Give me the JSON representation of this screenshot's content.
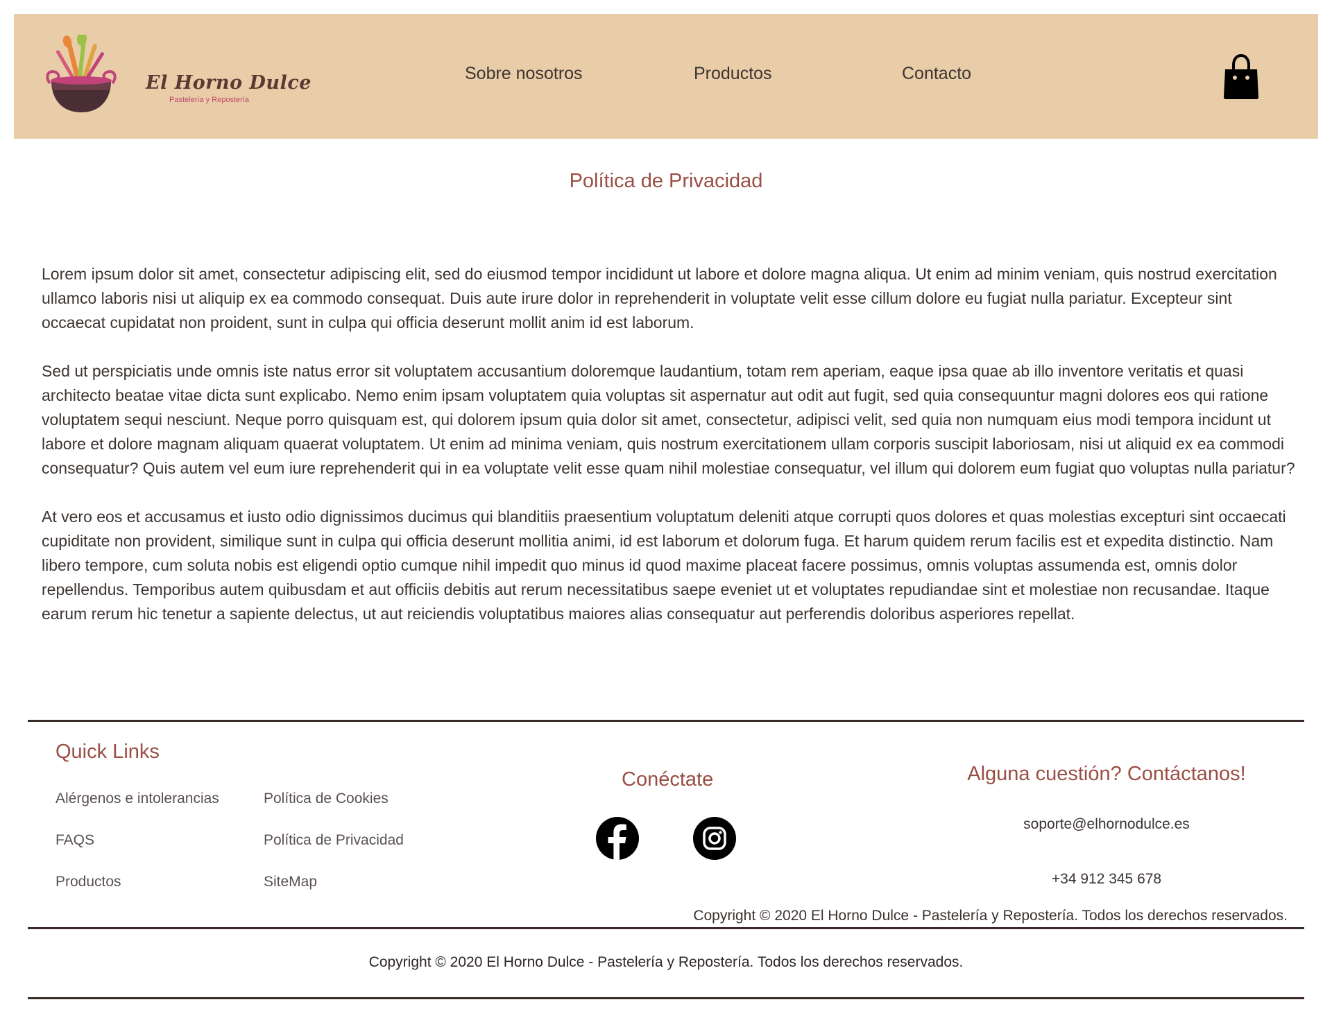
{
  "header": {
    "logo": {
      "name": "El Horno Dulce",
      "subtitle": "Pastelería y Repostería"
    },
    "nav": {
      "about": "Sobre nosotros",
      "products": "Productos",
      "contact": "Contacto"
    },
    "cart_icon": "shopping-bag-icon"
  },
  "main": {
    "title": "Política de Privacidad",
    "paragraphs": [
      "Lorem ipsum dolor sit amet, consectetur adipiscing elit, sed do eiusmod tempor incididunt ut labore et dolore magna aliqua. Ut enim ad minim veniam, quis nostrud exercitation ullamco laboris nisi ut aliquip ex ea commodo consequat. Duis aute irure dolor in reprehenderit in voluptate velit esse cillum dolore eu fugiat nulla pariatur. Excepteur sint occaecat cupidatat non proident, sunt in culpa qui officia deserunt mollit anim id est laborum.",
      "Sed ut perspiciatis unde omnis iste natus error sit voluptatem accusantium doloremque laudantium, totam rem aperiam, eaque ipsa quae ab illo inventore veritatis et quasi architecto beatae vitae dicta sunt explicabo. Nemo enim ipsam voluptatem quia voluptas sit aspernatur aut odit aut fugit, sed quia consequuntur magni dolores eos qui ratione voluptatem sequi nesciunt. Neque porro quisquam est, qui dolorem ipsum quia dolor sit amet, consectetur, adipisci velit, sed quia non numquam eius modi tempora incidunt ut labore et dolore magnam aliquam quaerat voluptatem. Ut enim ad minima veniam, quis nostrum exercitationem ullam corporis suscipit laboriosam, nisi ut aliquid ex ea commodi consequatur? Quis autem vel eum iure reprehenderit qui in ea voluptate velit esse quam nihil molestiae consequatur, vel illum qui dolorem eum fugiat quo voluptas nulla pariatur?",
      "At vero eos et accusamus et iusto odio dignissimos ducimus qui blanditiis praesentium voluptatum deleniti atque corrupti quos dolores et quas molestias excepturi sint occaecati cupiditate non provident, similique sunt in culpa qui officia deserunt mollitia animi, id est laborum et dolorum fuga. Et harum quidem rerum facilis est et expedita distinctio. Nam libero tempore, cum soluta nobis est eligendi optio cumque nihil impedit quo minus id quod maxime placeat facere possimus, omnis voluptas assumenda est, omnis dolor repellendus. Temporibus autem quibusdam et aut officiis debitis aut rerum necessitatibus saepe eveniet ut et voluptates repudiandae sint et molestiae non recusandae. Itaque earum rerum hic tenetur a sapiente delectus, ut aut reiciendis voluptatibus maiores alias consequatur aut perferendis doloribus asperiores repellat."
    ]
  },
  "footer": {
    "quick_links": {
      "title": "Quick Links",
      "links": [
        "Alérgenos e intolerancias",
        "Política de Cookies",
        "FAQS",
        "Política de Privacidad",
        "Productos",
        "SiteMap"
      ]
    },
    "connect": {
      "title": "Conéctate",
      "icons": [
        "facebook-icon",
        "instagram-icon"
      ]
    },
    "contact": {
      "title": "Alguna cuestión? Contáctanos!",
      "email": "soporte@elhornodulce.es",
      "phone": "+34 912 345 678"
    },
    "copyright_inner": "Copyright © 2020 El Horno Dulce - Pastelería y Repostería. Todos los derechos reservados.",
    "copyright_bottom": "Copyright © 2020 El Horno Dulce - Pastelería y Repostería. Todos los derechos reservados."
  },
  "colors": {
    "header_bg": "#e8cda8",
    "accent_title": "#9a4e44",
    "text": "#3b3431",
    "rule": "#3a2a28"
  }
}
